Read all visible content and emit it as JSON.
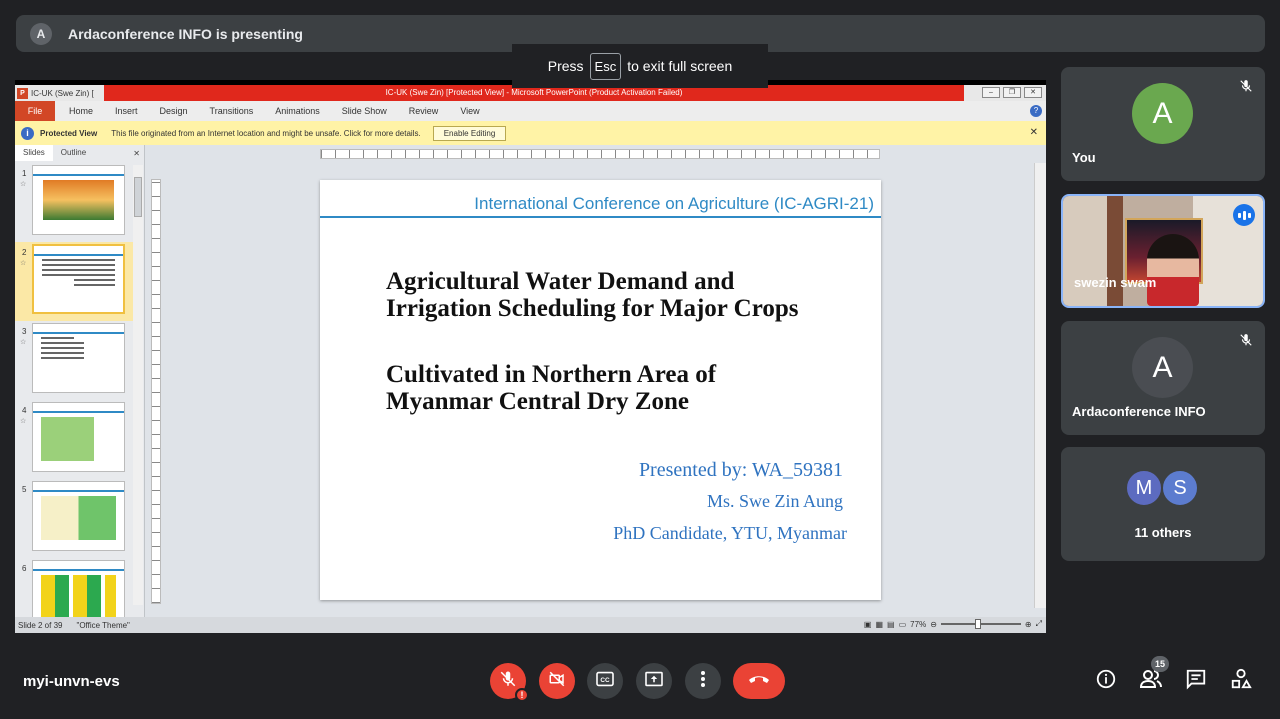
{
  "presenting_banner": {
    "avatar_letter": "A",
    "text": "Ardaconference INFO is presenting"
  },
  "fullscreen_toast": {
    "prefix": "Press",
    "key": "Esc",
    "suffix": "to exit full screen"
  },
  "powerpoint": {
    "window_tab": "IC-UK (Swe Zin) [",
    "window_title": "IC-UK (Swe Zin) [Protected View] - Microsoft PowerPoint (Product Activation Failed)",
    "ribbon_tabs": [
      "Home",
      "Insert",
      "Design",
      "Transitions",
      "Animations",
      "Slide Show",
      "Review",
      "View"
    ],
    "file_tab": "File",
    "protected_view": {
      "label": "Protected View",
      "message": "This file originated from an Internet location and might be unsafe. Click for more details.",
      "button": "Enable Editing"
    },
    "panel_tabs": [
      "Slides",
      "Outline"
    ],
    "thumbnails": [
      "1",
      "2",
      "3",
      "4",
      "5",
      "6"
    ],
    "slide": {
      "header": "International Conference on Agriculture (IC-AGRI-21)",
      "title_line1": "Agricultural Water Demand and",
      "title_line2": "Irrigation Scheduling for Major Crops",
      "title2_line1": "Cultivated in Northern Area of",
      "title2_line2": "Myanmar Central Dry Zone",
      "presented_by": "Presented by:  WA_59381",
      "name": "Ms. Swe Zin Aung",
      "affiliation": "PhD Candidate, YTU,  Myanmar"
    },
    "status": {
      "slide_counter": "Slide 2 of 39",
      "theme": "\"Office Theme\"",
      "zoom": "77%"
    }
  },
  "participants": [
    {
      "avatar_letter": "A",
      "name": "You",
      "avatar_color": "#6aa84f",
      "muted": true
    },
    {
      "name": "swezin swam",
      "video": true,
      "speaking": true
    },
    {
      "avatar_letter": "A",
      "name": "Ardaconference INFO",
      "avatar_color": "#4a4d52",
      "muted": true
    },
    {
      "avatars": [
        "M",
        "S"
      ],
      "label": "11 others"
    }
  ],
  "bottom_bar": {
    "meeting_code": "myi-unvn-evs",
    "people_count": "15",
    "icons": [
      "mic-off-icon",
      "camera-off-icon",
      "captions-icon",
      "present-icon",
      "more-icon",
      "end-call-icon",
      "info-icon",
      "people-icon",
      "chat-icon",
      "activities-icon"
    ]
  },
  "colors": {
    "end_call": "#ea4335",
    "accent_blue": "#8ab4f8",
    "ppt_red_titlebar": "#e0281c",
    "slide_blue": "#2f8ac5"
  }
}
